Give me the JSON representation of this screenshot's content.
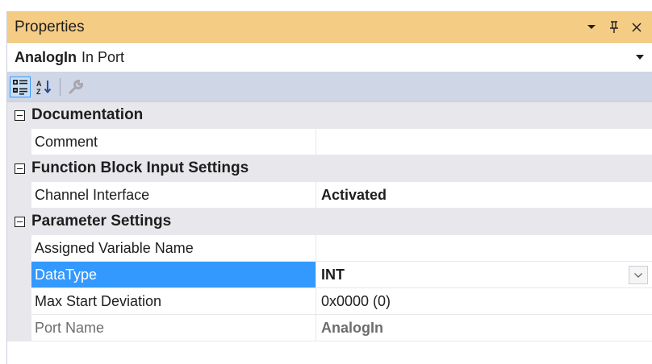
{
  "window": {
    "title": "Properties"
  },
  "titlebar_buttons": [
    {
      "name": "dropdown-icon",
      "glyph": "▾"
    },
    {
      "name": "pin-icon",
      "glyph": "⊥"
    },
    {
      "name": "close-icon",
      "glyph": "✕"
    }
  ],
  "object": {
    "name": "AnalogIn",
    "type": "In Port"
  },
  "toolbar": {
    "items": [
      "categorized-view-icon",
      "alphabetical-sort-icon",
      "property-pages-wrench-icon"
    ]
  },
  "categories": [
    {
      "label": "Documentation",
      "expanded": true,
      "properties": [
        {
          "name": "Comment",
          "value": ""
        }
      ]
    },
    {
      "label": "Function Block Input Settings",
      "expanded": true,
      "properties": [
        {
          "name": "Channel Interface",
          "value": "Activated",
          "bold": true
        }
      ]
    },
    {
      "label": "Parameter Settings",
      "expanded": true,
      "properties": [
        {
          "name": "Assigned Variable Name",
          "value": ""
        },
        {
          "name": "DataType",
          "value": "INT",
          "bold": true,
          "selected": true,
          "dropdown": true
        },
        {
          "name": "Max Start Deviation",
          "value": "0x0000 (0)"
        },
        {
          "name": "Port Name",
          "value": "AnalogIn",
          "bold": true,
          "readonly": true
        }
      ]
    }
  ],
  "colors": {
    "titlebar": "#f5cc84",
    "toolbar": "#cfd6e5",
    "category_bg": "#e8e8ec",
    "selection": "#3399ff"
  }
}
